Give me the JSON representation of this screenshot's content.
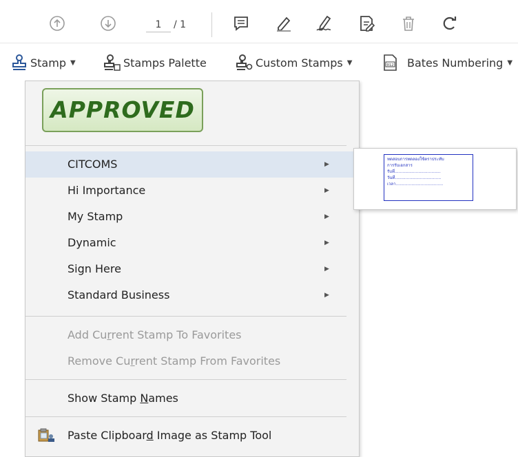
{
  "toolbar": {
    "page_current": "1",
    "page_total": "/ 1"
  },
  "stamp_toolbar": {
    "stamp_label": "Stamp",
    "palette_label": "Stamps Palette",
    "custom_label": "Custom Stamps",
    "bates_label": "Bates Numbering"
  },
  "menu": {
    "approved_text": "APPROVED",
    "categories": [
      {
        "label": "CITCOMS"
      },
      {
        "label": "Hi Importance"
      },
      {
        "label": "My Stamp"
      },
      {
        "label": "Dynamic"
      },
      {
        "label": "Sign Here"
      },
      {
        "label": "Standard Business"
      }
    ],
    "add_favorite": {
      "pre": "Add Cu",
      "key": "r",
      "post": "rent Stamp To Favorites"
    },
    "remove_favorite": {
      "pre": "Remove Cu",
      "key": "r",
      "post": "rent Stamp From Favorites"
    },
    "show_names": {
      "pre": "Show Stamp ",
      "key": "N",
      "post": "ames"
    },
    "paste_clipboard": {
      "pre": "Paste Clipboar",
      "key": "d",
      "post": " Image as Stamp Tool"
    }
  },
  "submenu": {
    "stamp_lines": [
      "ทดสอบการทดลองใช้ตราประทับ",
      "การรับเอกสาร",
      "รับที่...................................",
      "วันที่...................................",
      "เวลา...................................."
    ]
  },
  "colors": {
    "highlight": "#dde6f1",
    "menu_bg": "#f3f3f3",
    "approved_green": "#2e6b1d",
    "stamp_blue": "#2030c0"
  }
}
